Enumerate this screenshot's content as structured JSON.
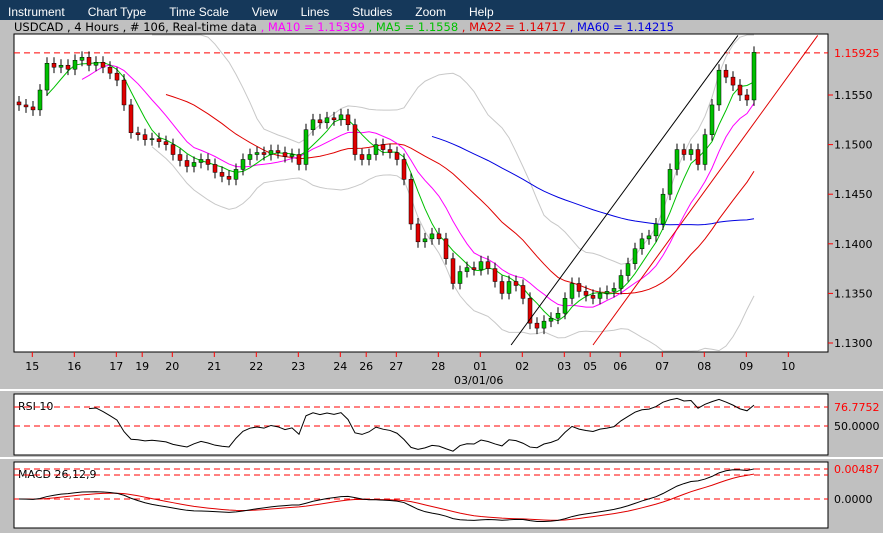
{
  "menu": [
    "Instrument",
    "Chart Type",
    "Time Scale",
    "View",
    "Lines",
    "Studies",
    "Zoom",
    "Help"
  ],
  "info": {
    "symbol": "USDCAD , 4 Hours , # 106, Real-time data",
    "ma10": ", MA10 = 1.15399",
    "ma5": ", MA5 = 1.1558",
    "ma22": ", MA22 = 1.14717",
    "ma60": ", MA60 = 1.14215"
  },
  "colors": {
    "ma10": "#ff00ff",
    "ma5": "#00c000",
    "ma22": "#e00000",
    "ma60": "#0000e0",
    "bollinger": "#c8c8c8",
    "up": "#00c000",
    "down": "#e00000",
    "ref": "#ff0000"
  },
  "chart_data": [
    {
      "type": "candlestick",
      "title": "USDCAD 4 Hours",
      "ylim": [
        1.1297,
        1.1612
      ],
      "yticks": [
        "1.1300",
        "1.1350",
        "1.1400",
        "1.1450",
        "1.1500",
        "1.1550"
      ],
      "last_price_label": "1.15925",
      "last_price": 1.15925,
      "date_label": "03/01/06",
      "xticks": [
        {
          "label": "15",
          "i": 1.9
        },
        {
          "label": "16",
          "i": 7.9
        },
        {
          "label": "17",
          "i": 13.9
        },
        {
          "label": "19",
          "i": 17.6
        },
        {
          "label": "20",
          "i": 21.9
        },
        {
          "label": "21",
          "i": 27.9
        },
        {
          "label": "22",
          "i": 33.9
        },
        {
          "label": "23",
          "i": 39.9
        },
        {
          "label": "24",
          "i": 45.9
        },
        {
          "label": "26",
          "i": 49.6
        },
        {
          "label": "27",
          "i": 53.9
        },
        {
          "label": "28",
          "i": 59.9
        },
        {
          "label": "01",
          "i": 65.9
        },
        {
          "label": "02",
          "i": 71.9
        },
        {
          "label": "03",
          "i": 77.9
        },
        {
          "label": "05",
          "i": 81.6
        },
        {
          "label": "06",
          "i": 85.9
        },
        {
          "label": "07",
          "i": 91.9
        },
        {
          "label": "08",
          "i": 97.9
        },
        {
          "label": "09",
          "i": 103.9
        },
        {
          "label": "10",
          "i": 109.9
        }
      ],
      "closes": [
        1.154,
        1.1538,
        1.1535,
        1.1555,
        1.1582,
        1.1578,
        1.158,
        1.1576,
        1.1585,
        1.1588,
        1.158,
        1.1583,
        1.1578,
        1.1572,
        1.1565,
        1.154,
        1.1512,
        1.151,
        1.1505,
        1.1506,
        1.1503,
        1.15,
        1.149,
        1.1484,
        1.1478,
        1.1482,
        1.1485,
        1.148,
        1.1472,
        1.1468,
        1.1465,
        1.1475,
        1.1485,
        1.149,
        1.1492,
        1.149,
        1.1494,
        1.1492,
        1.1488,
        1.149,
        1.148,
        1.1515,
        1.1525,
        1.1522,
        1.1527,
        1.1525,
        1.153,
        1.152,
        1.149,
        1.1485,
        1.149,
        1.15,
        1.1495,
        1.1492,
        1.1485,
        1.1465,
        1.142,
        1.1402,
        1.1405,
        1.141,
        1.1405,
        1.1385,
        1.136,
        1.1372,
        1.1376,
        1.1374,
        1.1382,
        1.1375,
        1.1362,
        1.135,
        1.1362,
        1.1358,
        1.1345,
        1.132,
        1.1315,
        1.1322,
        1.1325,
        1.133,
        1.1345,
        1.136,
        1.1352,
        1.1348,
        1.1345,
        1.135,
        1.1352,
        1.1355,
        1.1368,
        1.138,
        1.1395,
        1.1405,
        1.1408,
        1.142,
        1.145,
        1.1475,
        1.1495,
        1.149,
        1.1495,
        1.148,
        1.151,
        1.154,
        1.1575,
        1.1568,
        1.156,
        1.155,
        1.1545,
        1.1593
      ],
      "indicators": [
        "MA10",
        "MA5",
        "MA22",
        "MA60",
        "Bollinger"
      ],
      "trendlines": [
        {
          "color": "#000000",
          "from": [
            70.3,
            1.1298
          ],
          "to": [
            102.7,
            1.161
          ]
        },
        {
          "color": "#e00000",
          "from": [
            82,
            1.1298
          ],
          "to": [
            114.1,
            1.161
          ]
        }
      ]
    },
    {
      "type": "line",
      "title": "RSI 10",
      "ref_labels": [
        "76.7752",
        "50.0000"
      ],
      "refs": [
        76.7752,
        50
      ],
      "ylim": [
        10,
        95
      ]
    },
    {
      "type": "line",
      "title": "MACD 26,12,9",
      "ref_labels": [
        "0.00487",
        "0.0000"
      ],
      "refs": [
        0.00487,
        0
      ],
      "signal_ref": 0.0039
    }
  ]
}
